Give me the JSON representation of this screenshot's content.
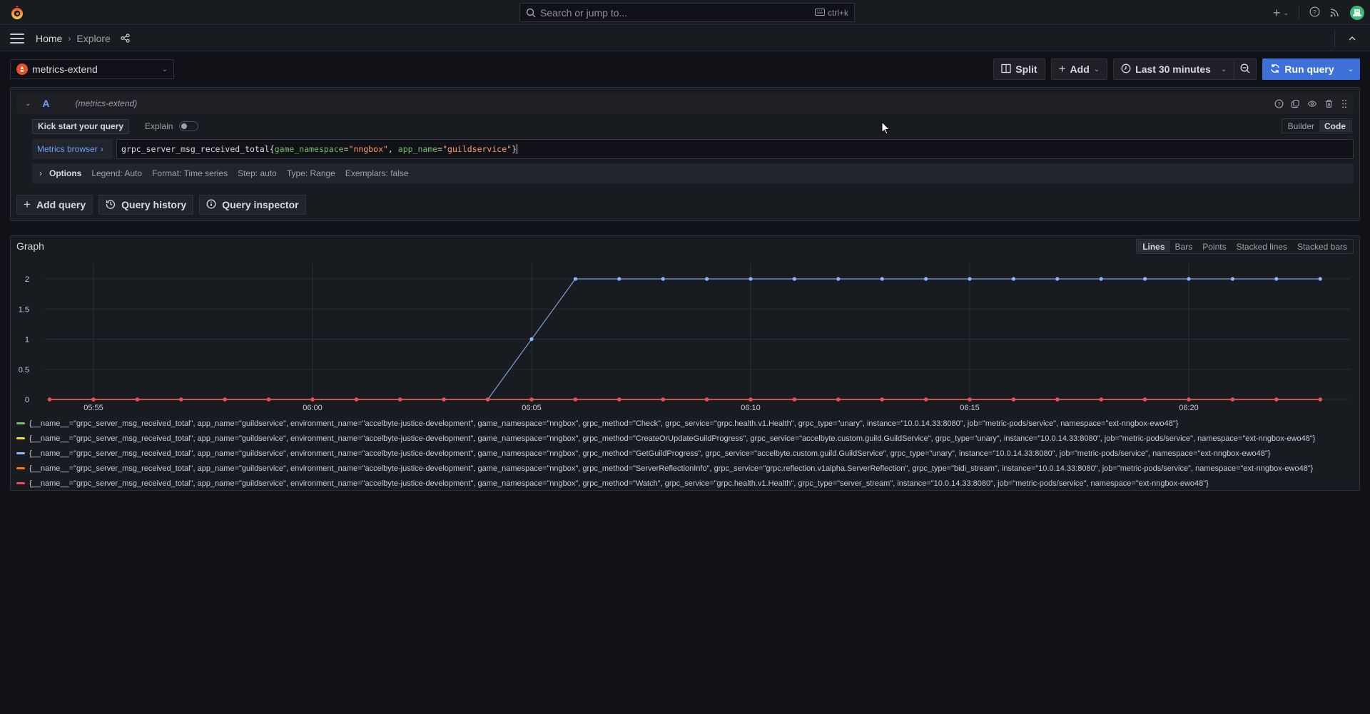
{
  "topbar": {
    "logo": "grafana-logo-icon",
    "search_placeholder": "Search or jump to...",
    "search_shortcut": "ctrl+k",
    "icons": [
      "plus-icon",
      "chevron-down-icon",
      "help-icon",
      "rss-icon",
      "avatar"
    ]
  },
  "nav": {
    "breadcrumbs": [
      {
        "label": "Home"
      },
      {
        "label": "Explore"
      }
    ],
    "icons": [
      "menu-icon",
      "share-icon",
      "chevron-up-icon"
    ]
  },
  "toolbar": {
    "datasource": "metrics-extend",
    "split_label": "Split",
    "add_label": "Add",
    "time_range": "Last 30 minutes",
    "run_label": "Run query"
  },
  "query": {
    "ref_id": "A",
    "datasource_hint": "(metrics-extend)",
    "kick_start": "Kick start your query",
    "explain_label": "Explain",
    "explain_on": false,
    "modes": [
      "Builder",
      "Code"
    ],
    "active_mode": "Code",
    "metrics_browser": "Metrics browser",
    "expr": {
      "metric": "grpc_server_msg_received_total",
      "labels": [
        {
          "name": "game_namespace",
          "value": "\"nngbox\""
        },
        {
          "name": "app_name",
          "value": "\"guildservice\""
        }
      ]
    },
    "options": {
      "label": "Options",
      "items": [
        "Legend: Auto",
        "Format: Time series",
        "Step: auto",
        "Type: Range",
        "Exemplars: false"
      ]
    },
    "buttons": {
      "add_query": "Add query",
      "history": "Query history",
      "inspector": "Query inspector"
    }
  },
  "graph": {
    "title": "Graph",
    "viz_options": [
      "Lines",
      "Bars",
      "Points",
      "Stacked lines",
      "Stacked bars"
    ],
    "active_viz": "Lines"
  },
  "chart_data": {
    "type": "line",
    "title": "Graph",
    "xlabel": "",
    "ylabel": "",
    "ylim": [
      0,
      2
    ],
    "yticks": [
      "0",
      "0.5",
      "1",
      "1.5",
      "2"
    ],
    "xticks": [
      "05:55",
      "06:00",
      "06:05",
      "06:10",
      "06:15",
      "06:20"
    ],
    "x": [
      "05:54",
      "05:55",
      "05:56",
      "05:57",
      "05:58",
      "05:59",
      "06:00",
      "06:01",
      "06:02",
      "06:03",
      "06:04",
      "06:05",
      "06:06",
      "06:07",
      "06:08",
      "06:09",
      "06:10",
      "06:11",
      "06:12",
      "06:13",
      "06:14",
      "06:15",
      "06:16",
      "06:17",
      "06:18",
      "06:19",
      "06:20",
      "06:21",
      "06:22",
      "06:23"
    ],
    "grid": true,
    "legend": "bottom",
    "series": [
      {
        "name": "{__name__=\"grpc_server_msg_received_total\", app_name=\"guildservice\", environment_name=\"accelbyte-justice-development\", game_namespace=\"nngbox\", grpc_method=\"Check\", grpc_service=\"grpc.health.v1.Health\", grpc_type=\"unary\", instance=\"10.0.14.33:8080\", job=\"metric-pods/service\", namespace=\"ext-nngbox-ewo48\"}",
        "color": "#73bf69",
        "values": [
          0,
          0,
          0,
          0,
          0,
          0,
          0,
          0,
          0,
          0,
          0,
          0,
          0,
          0,
          0,
          0,
          0,
          0,
          0,
          0,
          0,
          0,
          0,
          0,
          0,
          0,
          0,
          0,
          0,
          0
        ]
      },
      {
        "name": "{__name__=\"grpc_server_msg_received_total\", app_name=\"guildservice\", environment_name=\"accelbyte-justice-development\", game_namespace=\"nngbox\", grpc_method=\"CreateOrUpdateGuildProgress\", grpc_service=\"accelbyte.custom.guild.GuildService\", grpc_type=\"unary\", instance=\"10.0.14.33:8080\", job=\"metric-pods/service\", namespace=\"ext-nngbox-ewo48\"}",
        "color": "#fade2a",
        "values": [
          0,
          0,
          0,
          0,
          0,
          0,
          0,
          0,
          0,
          0,
          0,
          0,
          0,
          0,
          0,
          0,
          0,
          0,
          0,
          0,
          0,
          0,
          0,
          0,
          0,
          0,
          0,
          0,
          0,
          0
        ]
      },
      {
        "name": "{__name__=\"grpc_server_msg_received_total\", app_name=\"guildservice\", environment_name=\"accelbyte-justice-development\", game_namespace=\"nngbox\", grpc_method=\"GetGuildProgress\", grpc_service=\"accelbyte.custom.guild.GuildService\", grpc_type=\"unary\", instance=\"10.0.14.33:8080\", job=\"metric-pods/service\", namespace=\"ext-nngbox-ewo48\"}",
        "color": "#8ab8ff",
        "values": [
          null,
          null,
          null,
          null,
          null,
          null,
          null,
          null,
          null,
          null,
          0,
          1,
          2,
          2,
          2,
          2,
          2,
          2,
          2,
          2,
          2,
          2,
          2,
          2,
          2,
          2,
          2,
          2,
          2,
          2
        ]
      },
      {
        "name": "{__name__=\"grpc_server_msg_received_total\", app_name=\"guildservice\", environment_name=\"accelbyte-justice-development\", game_namespace=\"nngbox\", grpc_method=\"ServerReflectionInfo\", grpc_service=\"grpc.reflection.v1alpha.ServerReflection\", grpc_type=\"bidi_stream\", instance=\"10.0.14.33:8080\", job=\"metric-pods/service\", namespace=\"ext-nngbox-ewo48\"}",
        "color": "#ff780a",
        "values": [
          0,
          0,
          0,
          0,
          0,
          0,
          0,
          0,
          0,
          0,
          0,
          0,
          0,
          0,
          0,
          0,
          0,
          0,
          0,
          0,
          0,
          0,
          0,
          0,
          0,
          0,
          0,
          0,
          0,
          0
        ]
      },
      {
        "name": "{__name__=\"grpc_server_msg_received_total\", app_name=\"guildservice\", environment_name=\"accelbyte-justice-development\", game_namespace=\"nngbox\", grpc_method=\"Watch\", grpc_service=\"grpc.health.v1.Health\", grpc_type=\"server_stream\", instance=\"10.0.14.33:8080\", job=\"metric-pods/service\", namespace=\"ext-nngbox-ewo48\"}",
        "color": "#f2495c",
        "values": [
          0,
          0,
          0,
          0,
          0,
          0,
          0,
          0,
          0,
          0,
          0,
          0,
          0,
          0,
          0,
          0,
          0,
          0,
          0,
          0,
          0,
          0,
          0,
          0,
          0,
          0,
          0,
          0,
          0,
          0
        ]
      }
    ]
  },
  "colors": {
    "accent": "#3d71d9",
    "link": "#6e9fff",
    "background": "#111217",
    "panel": "#181b1f"
  }
}
